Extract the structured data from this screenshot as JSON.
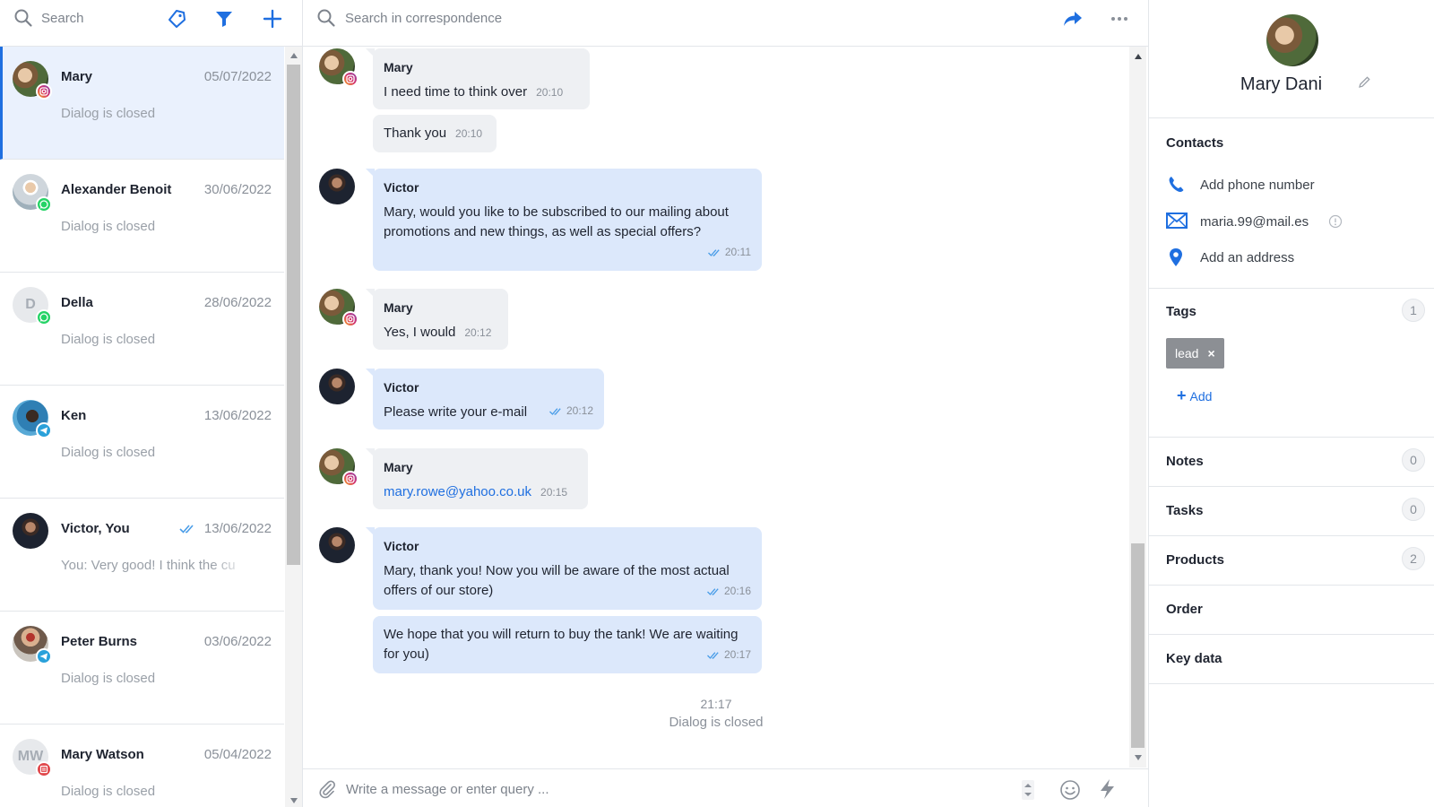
{
  "colors": {
    "accent": "#1f6fe0",
    "instagram": "#d6336c",
    "whatsapp": "#25d366",
    "telegram": "#2aa1da",
    "sms": "#e0464a",
    "active_bg": "#eaf1fd",
    "outgoing_bubble": "#dce8fb",
    "incoming_bubble": "#eef0f3"
  },
  "left": {
    "search_placeholder": "Search",
    "icons": [
      "search-icon",
      "tag-icon",
      "filter-icon",
      "plus-icon"
    ],
    "dialogs": [
      {
        "name": "Mary",
        "date": "05/07/2022",
        "status": "Dialog is closed",
        "channel": "instagram",
        "avatar": "photo",
        "active": true
      },
      {
        "name": "Alexander Benoit",
        "date": "30/06/2022",
        "status": "Dialog is closed",
        "channel": "whatsapp",
        "avatar": "photo"
      },
      {
        "name": "Della",
        "date": "28/06/2022",
        "status": "Dialog is closed",
        "channel": "whatsapp",
        "avatar": "D"
      },
      {
        "name": "Ken",
        "date": "13/06/2022",
        "status": "Dialog is closed",
        "channel": "telegram",
        "avatar": "photo"
      },
      {
        "name": "Victor, You",
        "date": "13/06/2022",
        "status": "You: Very good! I think the cu",
        "channel": "none",
        "avatar": "photo",
        "read": true
      },
      {
        "name": "Peter Burns",
        "date": "03/06/2022",
        "status": "Dialog is closed",
        "channel": "telegram",
        "avatar": "photo"
      },
      {
        "name": "Mary Watson",
        "date": "05/04/2022",
        "status": "Dialog is closed",
        "channel": "sms",
        "avatar": "MW"
      }
    ]
  },
  "middle": {
    "search_placeholder": "Search in correspondence",
    "icons": [
      "forward-icon",
      "more-icon"
    ],
    "messages": [
      {
        "author": "Mary",
        "text": "I need time to think over",
        "time": "20:10",
        "direction": "in"
      },
      {
        "author": "",
        "text": "Thank you",
        "time": "20:10",
        "direction": "in"
      },
      {
        "author": "Victor",
        "text": "Mary, would you like to be subscribed to our mailing about promotions and new things, as well as special offers?",
        "time": "20:11",
        "direction": "out"
      },
      {
        "author": "Mary",
        "text": "Yes, I would",
        "time": "20:12",
        "direction": "in"
      },
      {
        "author": "Victor",
        "text": "Please write your e-mail",
        "time": "20:12",
        "direction": "out"
      },
      {
        "author": "Mary",
        "text": "mary.rowe@yahoo.co.uk",
        "time": "20:15",
        "direction": "in",
        "is_link": true
      },
      {
        "author": "Victor",
        "text": "Mary, thank you! Now you will be aware of the most actual offers of our store)",
        "time": "20:16",
        "direction": "out"
      },
      {
        "author": "",
        "text": "We hope that you will return to buy the tank! We are waiting for you)",
        "time": "20:17",
        "direction": "out"
      }
    ],
    "system_time": "21:17",
    "system_status": "Dialog is closed",
    "composer_placeholder": "Write a message or enter query ...",
    "composer_icons": [
      "paperclip-icon",
      "stepper-icon",
      "smile-icon",
      "bolt-icon"
    ]
  },
  "right": {
    "profile_name": "Mary Dani",
    "contacts_title": "Contacts",
    "phone_label": "Add phone number",
    "email_value": "maria.99@mail.es",
    "address_label": "Add an address",
    "tags_title": "Tags",
    "tags_count": "1",
    "tags": [
      "lead"
    ],
    "tag_remove": "×",
    "add_tag_label": "Add",
    "add_tag_plus": "+",
    "sections": [
      {
        "title": "Notes",
        "count": "0"
      },
      {
        "title": "Tasks",
        "count": "0"
      },
      {
        "title": "Products",
        "count": "2"
      },
      {
        "title": "Order",
        "count": ""
      },
      {
        "title": "Key data",
        "count": ""
      }
    ]
  }
}
